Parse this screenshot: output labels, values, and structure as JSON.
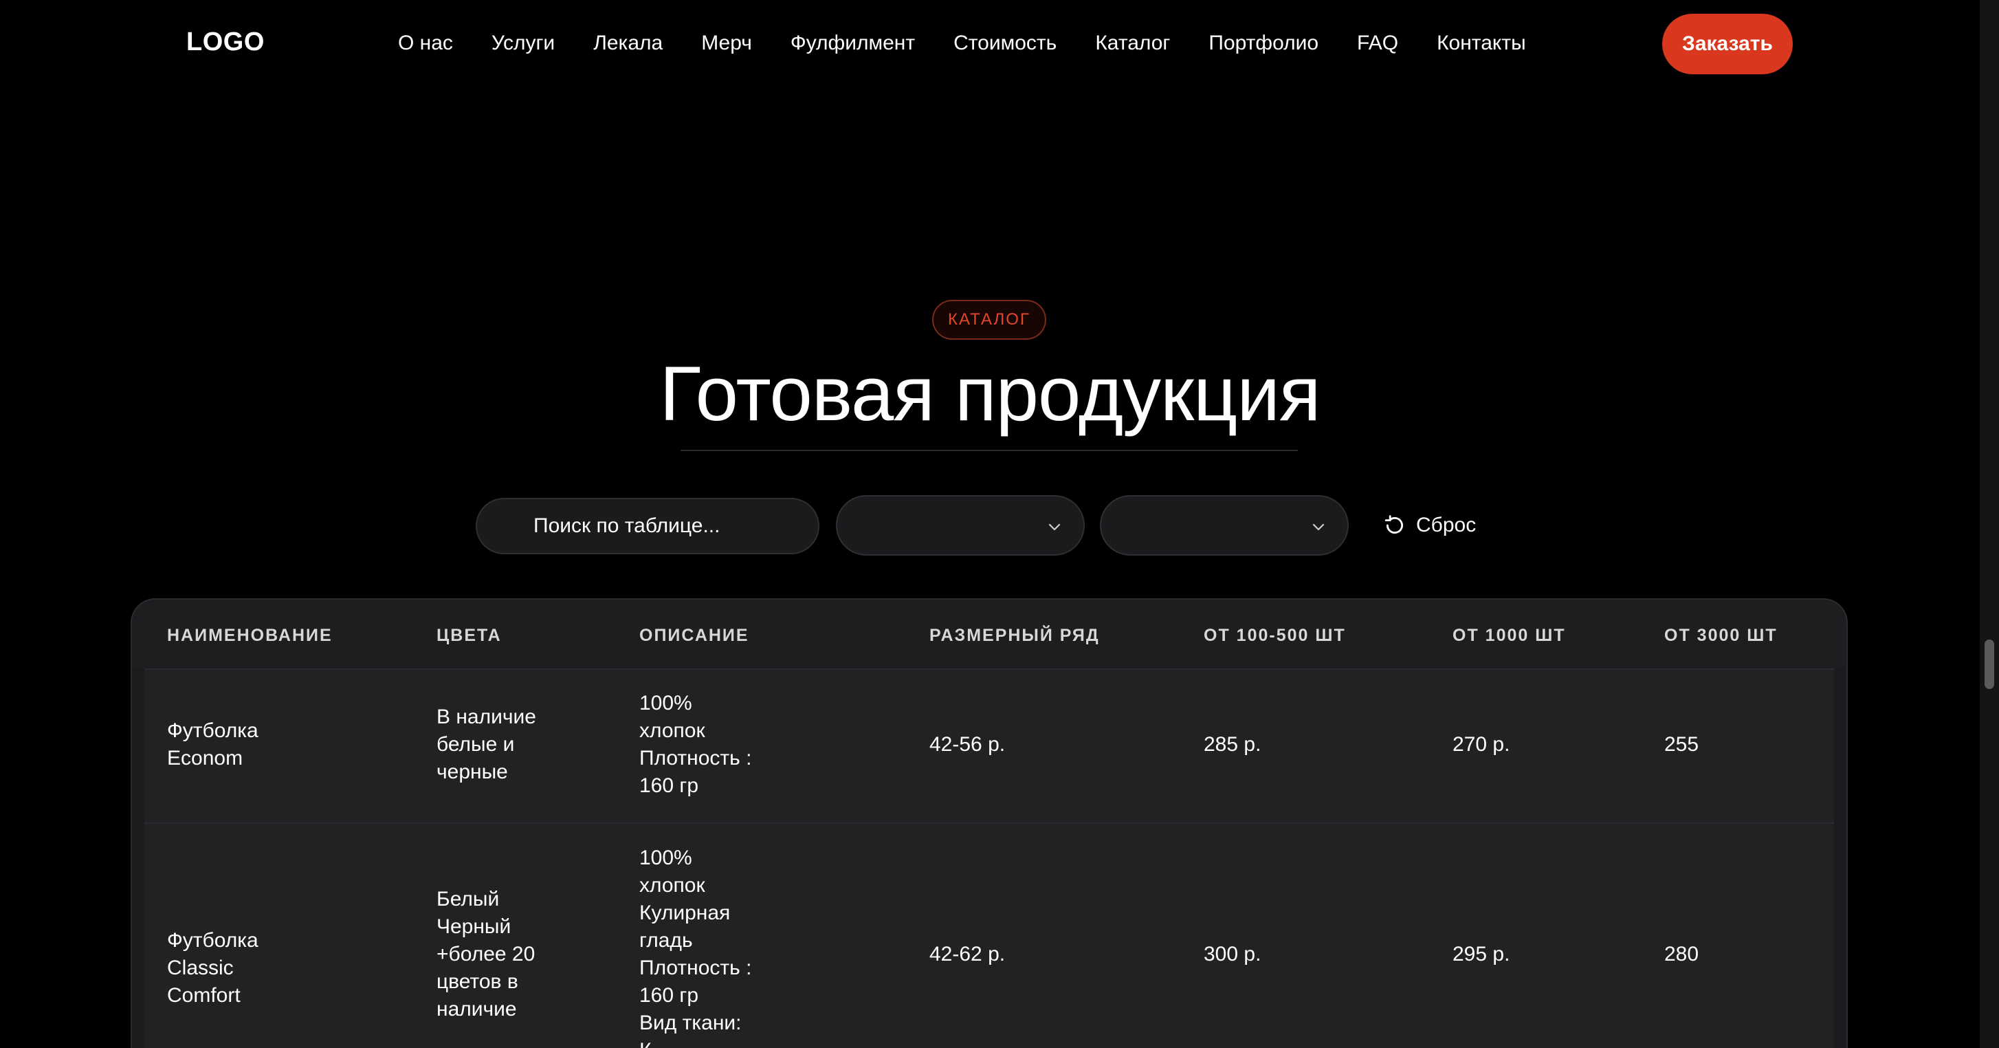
{
  "header": {
    "logo": "LOGO",
    "nav": [
      "О нас",
      "Услуги",
      "Лекала",
      "Мерч",
      "Фулфилмент",
      "Стоимость",
      "Каталог",
      "Портфолио",
      "FAQ",
      "Контакты"
    ],
    "order_label": "Заказать"
  },
  "section": {
    "badge": "КАТАЛОГ",
    "title": "Готовая продукция"
  },
  "filters": {
    "search_placeholder": "Поиск по таблице...",
    "select_one_value": "",
    "select_two_value": "",
    "reset_label": "Сброс"
  },
  "table": {
    "headers": [
      "НАИМЕНОВАНИЕ",
      "ЦВЕТА",
      "ОПИСАНИЕ",
      "РАЗМЕРНЫЙ РЯД",
      "ОТ 100-500 ШТ",
      "ОТ 1000 ШТ",
      "ОТ 3000 ШТ"
    ],
    "rows": [
      {
        "name": [
          "Футболка",
          "Econom"
        ],
        "colors": [
          "В наличие",
          "белые и",
          "черные"
        ],
        "description": [
          "100%",
          "хлопок",
          "Плотность :",
          "160 гр"
        ],
        "sizes": "42-56 р.",
        "price_100_500": "285 р.",
        "price_1000": "270 р.",
        "price_3000": "255"
      },
      {
        "name": [
          "Футболка",
          "Classic",
          "Comfort"
        ],
        "colors": [
          "Белый",
          "Черный",
          "+более 20",
          "цветов в",
          "наличие"
        ],
        "description": [
          "100%",
          "хлопок",
          "Кулирная",
          "гладь",
          "Плотность :",
          "160 гр",
          "Вид ткани:",
          "К"
        ],
        "sizes": "42-62 р.",
        "price_100_500": "300 р.",
        "price_1000": "295 р.",
        "price_3000": "280"
      }
    ]
  },
  "colors": {
    "accent": "#d9381e",
    "badge_text": "#e2462b",
    "background": "#000000",
    "panel": "#1b1c1e"
  }
}
